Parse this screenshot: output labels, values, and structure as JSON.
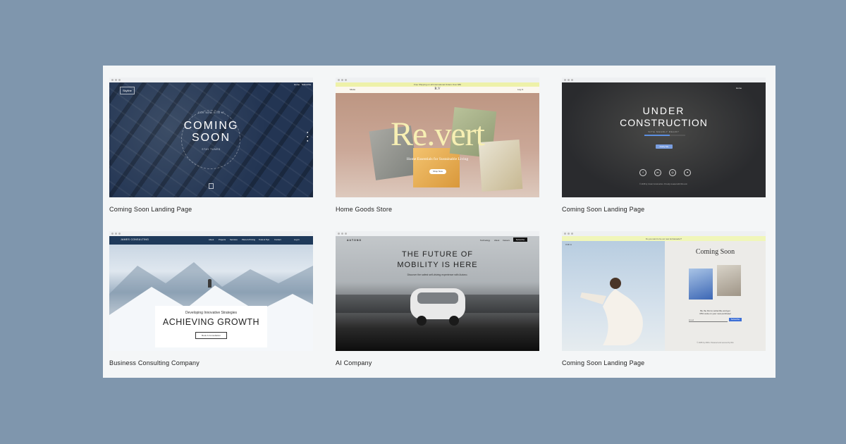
{
  "section": {
    "heading": ""
  },
  "cards": [
    {
      "label": "Coming Soon Landing Page",
      "preview": {
        "logo": "Skyline",
        "nav": [
          "Home",
          "Subscribe"
        ],
        "kicker": "OUR NEW SITE IS",
        "title_line1": "COMING",
        "title_line2": "SOON",
        "subtitle": "STAY TUNED"
      }
    },
    {
      "label": "Home Goods Store",
      "preview": {
        "announcement": "Free Shipping on all International Orders Over $50",
        "menu": "Menu",
        "logo": "R.V",
        "login": "Log In",
        "title": "Re.vert",
        "tagline": "Home Essentials for Sustainable Living",
        "button": "Shop Now"
      }
    },
    {
      "label": "Coming Soon Landing Page",
      "preview": {
        "nav": "Home",
        "title_line1": "UNDER",
        "title_line2": "CONSTRUCTION",
        "subtitle": "SITE NEARLY READY",
        "progress": 0.62,
        "button": "Notify Me",
        "footer": "© 2035 by Under Construction. Proudly created with Wix.com",
        "social_icons": [
          "facebook-icon",
          "linkedin-icon",
          "instagram-icon",
          "twitter-icon"
        ]
      }
    },
    {
      "label": "Business Consulting Company",
      "preview": {
        "logo": "JAMES CONSULTING",
        "nav": [
          "About",
          "Projects",
          "Services",
          "Plans & Pricing",
          "Tools & Tips",
          "Contact"
        ],
        "login": "Log In",
        "kicker": "Developing Innovative Strategies",
        "title": "ACHIEVING GROWTH",
        "button": "Book A Consultation"
      }
    },
    {
      "label": "AI Company",
      "preview": {
        "logo": "AUTONO",
        "nav": [
          "Technology",
          "About",
          "Careers"
        ],
        "nav_button": "Subscribe",
        "title_line1": "THE FUTURE OF",
        "title_line2": "MOBILITY IS HERE",
        "subtitle": "Discover the safest self-driving experience with Autono."
      }
    },
    {
      "label": "Coming Soon Landing Page",
      "preview": {
        "announcement": "Do you want to be our new Ambassador?",
        "logo": "ORIA",
        "title": "Coming Soon",
        "subscribe_line1": "Be the first to subscribe and get",
        "subscribe_line2": "15% code on your next purchase!",
        "email_placeholder": "Email",
        "button": "Subscribe",
        "footer": "© 2035 by ORIA. Powered and secured by Wix"
      }
    }
  ],
  "colors": {
    "page_bg": "#7f96ad",
    "panel_bg": "#f4f6f7"
  }
}
